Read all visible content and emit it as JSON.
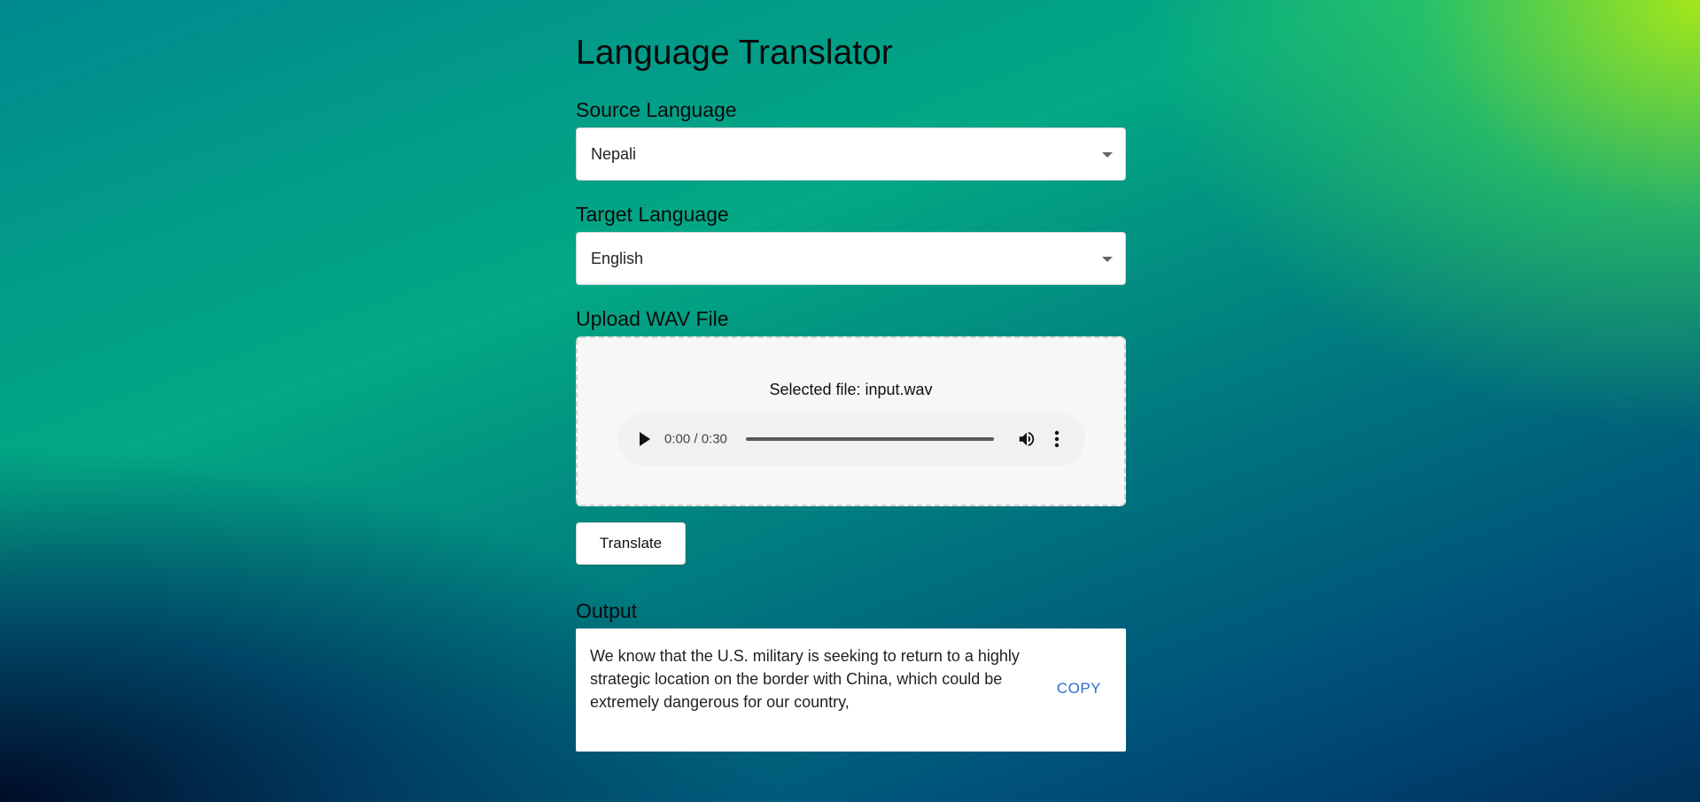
{
  "app": {
    "title": "Language Translator"
  },
  "source": {
    "label": "Source Language",
    "selected": "Nepali"
  },
  "target": {
    "label": "Target Language",
    "selected": "English"
  },
  "upload": {
    "label": "Upload WAV File",
    "selected_file_text": "Selected file: input.wav",
    "player": {
      "time": "0:00 / 0:30",
      "progress": 0
    }
  },
  "actions": {
    "translate_label": "Translate",
    "copy_label": "COPY"
  },
  "output": {
    "label": "Output",
    "text": "We know that the U.S. military is seeking to return to a highly strategic location on the border with China, which could be extremely dangerous for our country,"
  },
  "icons": {
    "dropdown": "chevron-down-icon",
    "play": "play-icon",
    "volume": "volume-icon",
    "more": "more-vertical-icon"
  },
  "colors": {
    "copy_link": "#2a6fc9"
  }
}
